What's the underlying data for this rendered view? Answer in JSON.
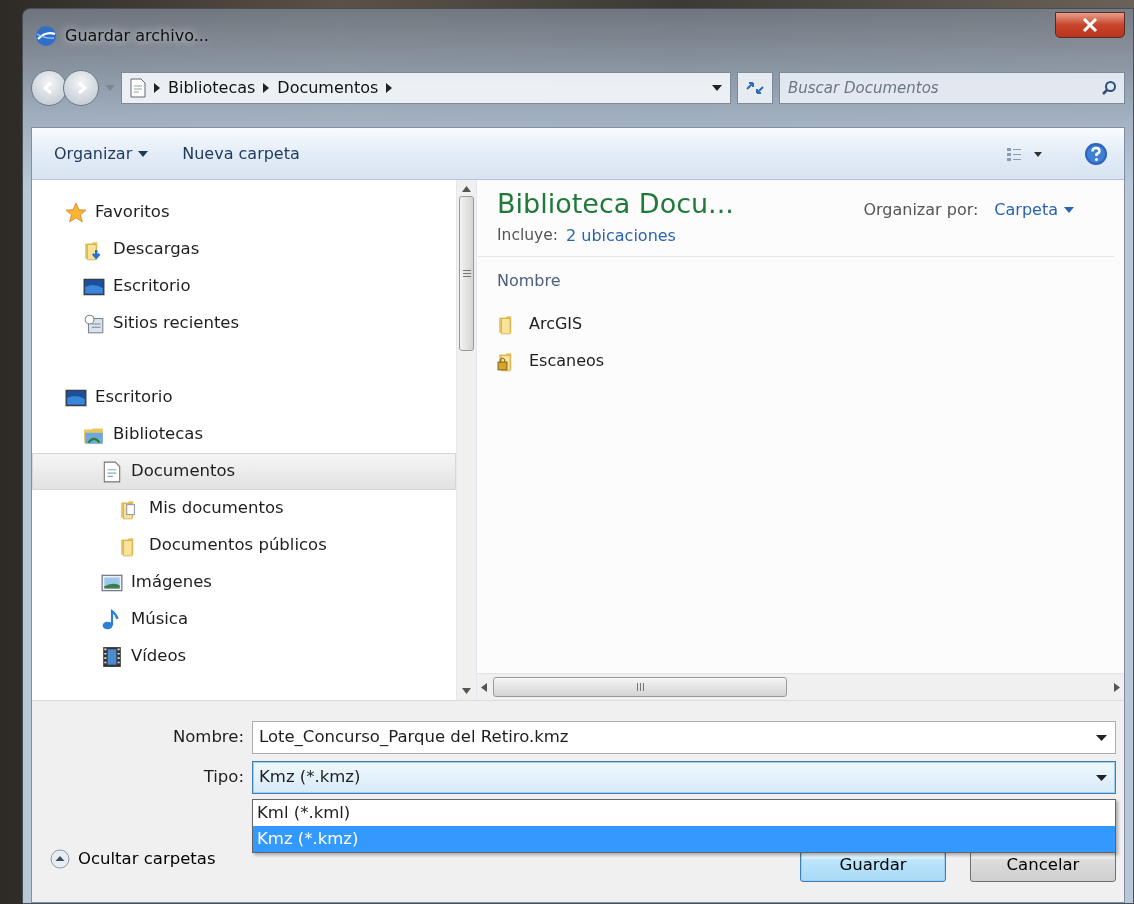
{
  "window": {
    "title": "Guardar archivo..."
  },
  "address_bar": {
    "breadcrumbs": [
      "Bibliotecas",
      "Documentos"
    ]
  },
  "search": {
    "placeholder": "Buscar Documentos"
  },
  "toolbar": {
    "items": [
      {
        "label": "Organizar",
        "kind": "menu"
      },
      {
        "label": "Nueva carpeta",
        "kind": "button"
      }
    ]
  },
  "nav_tree": [
    {
      "label": "Favoritos",
      "kind": "star",
      "selected": false,
      "children": [
        {
          "label": "Descargas",
          "kind": "download-folder",
          "selected": false
        },
        {
          "label": "Escritorio",
          "kind": "desktop",
          "selected": false
        },
        {
          "label": "Sitios recientes",
          "kind": "recent",
          "selected": false
        }
      ]
    },
    {
      "label": "Escritorio",
      "kind": "desktop",
      "selected": false,
      "children": [
        {
          "label": "Bibliotecas",
          "kind": "library",
          "selected": false,
          "children": [
            {
              "label": "Documentos",
              "kind": "document",
              "selected": true,
              "children": [
                {
                  "label": "Mis documentos",
                  "kind": "doc-folder",
                  "selected": false
                },
                {
                  "label": "Documentos públicos",
                  "kind": "folder",
                  "selected": false
                }
              ]
            },
            {
              "label": "Imágenes",
              "kind": "pictures",
              "selected": false
            },
            {
              "label": "Música",
              "kind": "music",
              "selected": false
            },
            {
              "label": "Vídeos",
              "kind": "videos",
              "selected": false
            }
          ]
        }
      ]
    }
  ],
  "library": {
    "title": "Biblioteca Docu...",
    "includes_label": "Incluye:",
    "includes_link": "2 ubicaciones",
    "arrange_label": "Organizar por:",
    "arrange_value": "Carpeta"
  },
  "file_list": {
    "column": "Nombre",
    "items": [
      {
        "name": "ArcGIS",
        "kind": "folder"
      },
      {
        "name": "Escaneos",
        "kind": "locked-folder"
      }
    ]
  },
  "form": {
    "name_label": "Nombre:",
    "name_value": "Lote_Concurso_Parque del Retiro.kmz",
    "type_label": "Tipo:",
    "type_value": "Kmz (*.kmz)",
    "type_options": [
      {
        "label": "Kml (*.kml)",
        "selected": false
      },
      {
        "label": "Kmz (*.kmz)",
        "selected": true
      }
    ]
  },
  "hide_folders": "Ocultar carpetas",
  "buttons": [
    "Guardar",
    "Cancelar"
  ]
}
